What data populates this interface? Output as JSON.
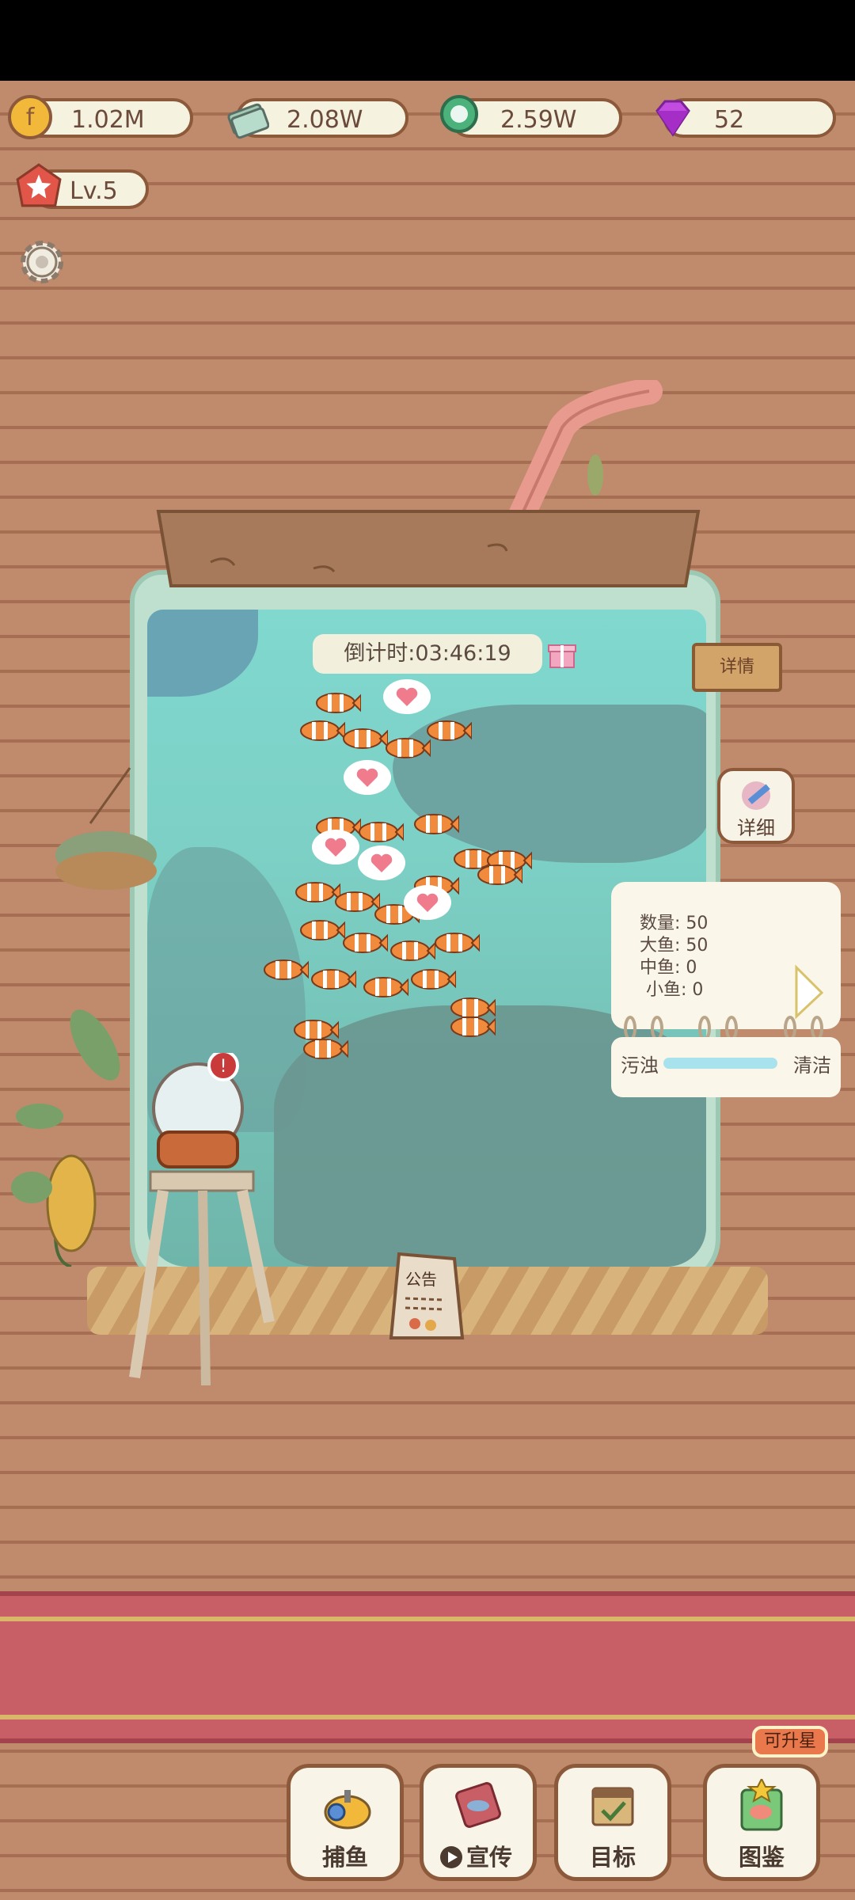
{
  "resources": {
    "gold": "1.02M",
    "cash": "2.08W",
    "shell": "2.59W",
    "gem": "52"
  },
  "player": {
    "level": "Lv.5"
  },
  "tank": {
    "countdown": "倒计时:03:46:19",
    "sign_label": "详情",
    "detail_button_label": "详细",
    "info": {
      "total": "数量: 50",
      "large": "大鱼: 50",
      "medium": "中鱼: 0",
      "small": "小鱼: 0"
    },
    "cleanliness": {
      "dirty_label": "污浊",
      "clean_label": "清洁",
      "level": 1.0
    },
    "notice_label": "公告"
  },
  "nav": {
    "fish_label": "捕鱼",
    "promote_label": "宣传",
    "goal_label": "目标",
    "album_label": "图鉴",
    "upgrade_badge": "可升星"
  },
  "icons": {
    "gold": "coin-icon",
    "cash": "money-stack-icon",
    "shell": "green-shell-icon",
    "gem": "purple-gem-icon",
    "level": "star-icon",
    "settings": "gear-icon"
  },
  "colors": {
    "wood": "#c08a6c",
    "banner": "#c85e66",
    "water": "#80d8cf",
    "fish": "#f08a3c"
  }
}
